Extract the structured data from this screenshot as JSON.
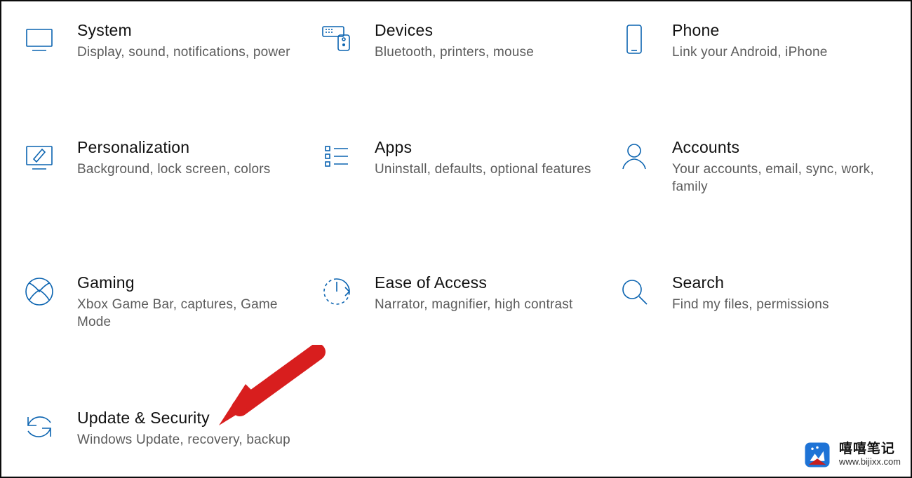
{
  "categories": [
    {
      "id": "system",
      "icon": "monitor-icon",
      "title": "System",
      "desc": "Display, sound, notifications, power"
    },
    {
      "id": "devices",
      "icon": "devices-icon",
      "title": "Devices",
      "desc": "Bluetooth, printers, mouse"
    },
    {
      "id": "phone",
      "icon": "phone-icon",
      "title": "Phone",
      "desc": "Link your Android, iPhone"
    },
    {
      "id": "personalization",
      "icon": "personalize-icon",
      "title": "Personalization",
      "desc": "Background, lock screen, colors"
    },
    {
      "id": "apps",
      "icon": "apps-list-icon",
      "title": "Apps",
      "desc": "Uninstall, defaults, optional features"
    },
    {
      "id": "accounts",
      "icon": "person-icon",
      "title": "Accounts",
      "desc": "Your accounts, email, sync, work, family"
    },
    {
      "id": "gaming",
      "icon": "xbox-icon",
      "title": "Gaming",
      "desc": "Xbox Game Bar, captures, Game Mode"
    },
    {
      "id": "ease-of-access",
      "icon": "ease-access-icon",
      "title": "Ease of Access",
      "desc": "Narrator, magnifier, high contrast"
    },
    {
      "id": "search",
      "icon": "search-icon",
      "title": "Search",
      "desc": "Find my files, permissions"
    },
    {
      "id": "update-security",
      "icon": "sync-icon",
      "title": "Update & Security",
      "desc": "Windows Update, recovery, backup"
    }
  ],
  "annotation": {
    "target": "update-security",
    "type": "red-arrow"
  },
  "watermark": {
    "line1": "嘻嘻笔记",
    "line2": "www.bijixx.com"
  }
}
